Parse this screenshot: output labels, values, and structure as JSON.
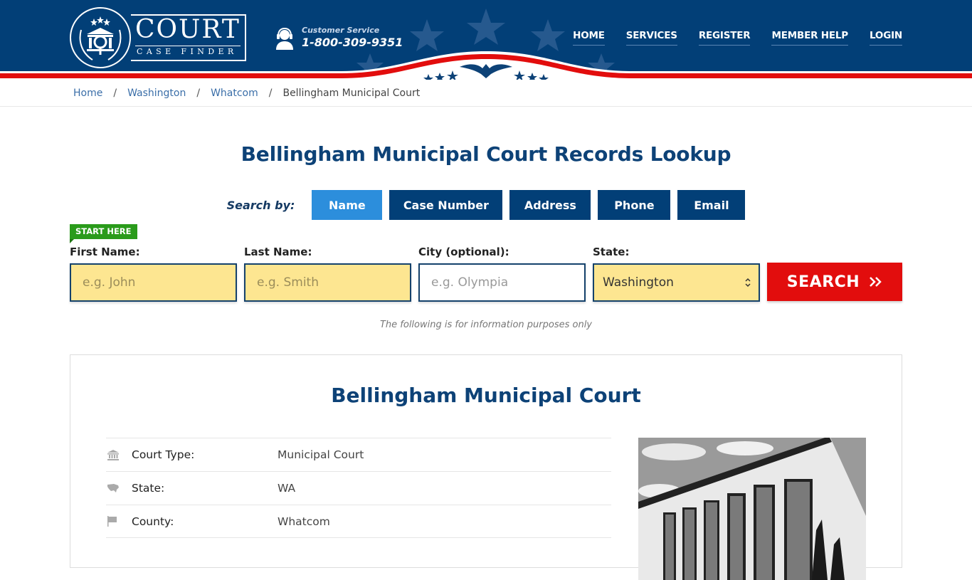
{
  "header": {
    "logo_main": "COURT",
    "logo_sub": "CASE FINDER",
    "customer_service_label": "Customer Service",
    "customer_service_phone": "1-800-309-9351",
    "nav": [
      {
        "label": "HOME"
      },
      {
        "label": "SERVICES"
      },
      {
        "label": "REGISTER"
      },
      {
        "label": "MEMBER HELP"
      },
      {
        "label": "LOGIN"
      }
    ]
  },
  "breadcrumb": {
    "items": [
      {
        "label": "Home",
        "link": true
      },
      {
        "label": "Washington",
        "link": true
      },
      {
        "label": "Whatcom",
        "link": true
      },
      {
        "label": "Bellingham Municipal Court",
        "link": false
      }
    ]
  },
  "page_title": "Bellingham Municipal Court Records Lookup",
  "search": {
    "search_by_label": "Search by:",
    "tabs": [
      {
        "label": "Name",
        "active": true
      },
      {
        "label": "Case Number",
        "active": false
      },
      {
        "label": "Address",
        "active": false
      },
      {
        "label": "Phone",
        "active": false
      },
      {
        "label": "Email",
        "active": false
      }
    ],
    "start_here": "START HERE",
    "fields": {
      "first_name": {
        "label": "First Name:",
        "placeholder": "e.g. John",
        "value": ""
      },
      "last_name": {
        "label": "Last Name:",
        "placeholder": "e.g. Smith",
        "value": ""
      },
      "city": {
        "label": "City (optional):",
        "placeholder": "e.g.  Olympia",
        "value": ""
      },
      "state": {
        "label": "State:",
        "value": "Washington"
      }
    },
    "search_button": "SEARCH",
    "info_note": "The following is for information purposes only"
  },
  "court": {
    "title": "Bellingham Municipal Court",
    "details": [
      {
        "icon": "courthouse-icon",
        "label": "Court Type:",
        "value": "Municipal Court"
      },
      {
        "icon": "us-map-icon",
        "label": "State:",
        "value": "WA"
      },
      {
        "icon": "flag-icon",
        "label": "County:",
        "value": "Whatcom"
      }
    ]
  },
  "colors": {
    "brand_blue": "#023f77",
    "active_tab": "#2c8edc",
    "search_red": "#e20d0d",
    "start_green": "#2a9b1b",
    "input_yellow": "#fde691"
  }
}
